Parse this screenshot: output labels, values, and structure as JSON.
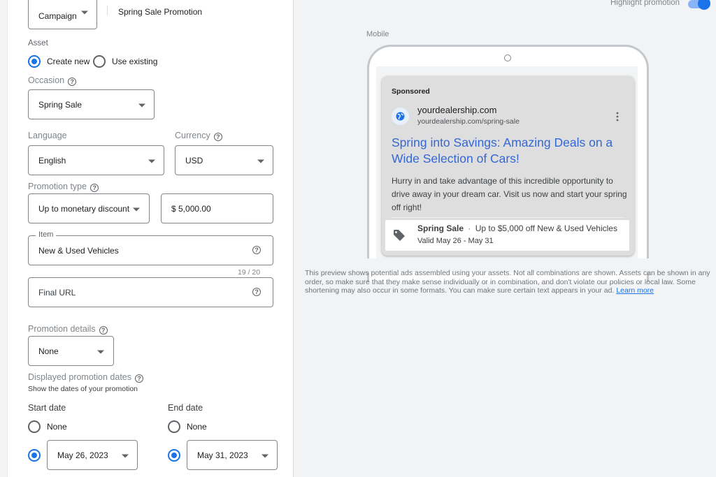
{
  "form": {
    "level_select": "Campaign",
    "campaign_name": "Spring Sale Promotion",
    "asset": {
      "label": "Asset",
      "options": [
        {
          "label": "Create new",
          "selected": true
        },
        {
          "label": "Use existing",
          "selected": false
        }
      ]
    },
    "occasion": {
      "label": "Occasion",
      "value": "Spring Sale"
    },
    "language": {
      "label": "Language",
      "value": "English"
    },
    "currency": {
      "label": "Currency",
      "value": "USD"
    },
    "promotion_type": {
      "label": "Promotion type",
      "value": "Up to monetary discount",
      "amount": "$ 5,000.00"
    },
    "item": {
      "label": "Item",
      "value": "New & Used Vehicles",
      "counter": "19 / 20"
    },
    "final_url": {
      "placeholder": "Final URL"
    },
    "promotion_details": {
      "label": "Promotion details",
      "value": "None"
    },
    "displayed_dates": {
      "label": "Displayed promotion dates",
      "sublabel": "Show the dates of your promotion"
    },
    "start_date": {
      "label": "Start date",
      "none_label": "None",
      "value": "May 26, 2023",
      "date_selected": true
    },
    "end_date": {
      "label": "End date",
      "none_label": "None",
      "value": "May 31, 2023",
      "date_selected": true
    }
  },
  "preview": {
    "highlight_label": "Highlight promotion",
    "highlight_on": true,
    "device_label": "Mobile",
    "ad": {
      "sponsored": "Sponsored",
      "site_name": "yourdealership.com",
      "display_url": "yourdealership.com/spring-sale",
      "headline": "Spring into Savings: Amazing Deals on a Wide Selection of Cars!",
      "description": "Hurry in and take advantage of this incredible opportunity to drive away in your dream car. Visit us now and start your spring off right!",
      "promo_occasion": "Spring Sale",
      "promo_separator": "·",
      "promo_text": "Up to $5,000 off New & Used Vehicles",
      "promo_dates": "Valid May 26 - May 31"
    },
    "disclaimer": "This preview shows potential ads assembled using your assets. Not all combinations are shown. Assets can be shown in any order, so make sure that they make sense individually or in combination, and don't violate our policies or local law. Some shortening may also occur in some formats. You can make sure certain text appears in your ad.",
    "learn_more": "Learn more"
  },
  "colors": {
    "accent": "#1a73e8",
    "headline": "#1a0dab"
  }
}
